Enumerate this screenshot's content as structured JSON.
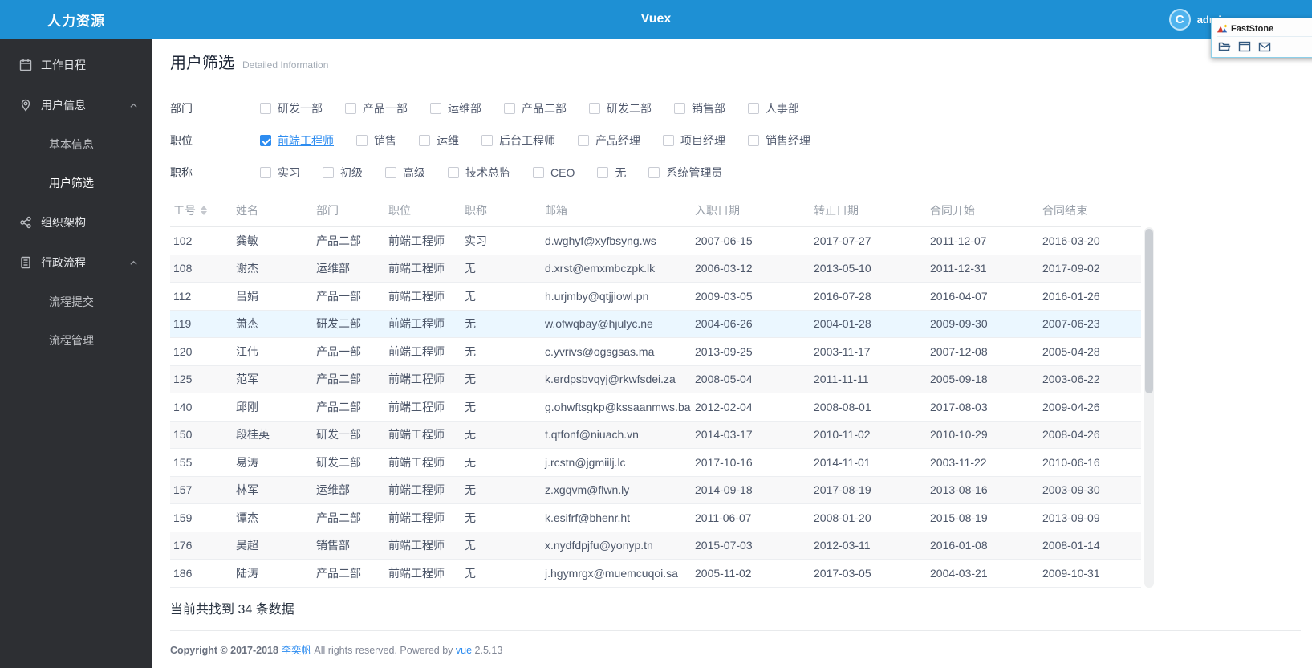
{
  "colors": {
    "header_blue": "#1e90d4",
    "accent_blue": "#2d8cf0",
    "sidebar_bg": "#2d2f33",
    "row_highlight": "#ebf7ff",
    "row_stripe": "#f8f8f9"
  },
  "header": {
    "app_title": "人力资源",
    "center_title": "Vuex",
    "username": "admin",
    "avatar_letter": "C"
  },
  "faststone": {
    "title": "FastStone",
    "icons": [
      "open-folder-icon",
      "window-icon",
      "envelope-icon"
    ]
  },
  "sidebar": {
    "items": [
      {
        "label": "工作日程",
        "icon": "calendar-icon"
      },
      {
        "label": "用户信息",
        "icon": "location-pin-icon",
        "expanded": true,
        "children": [
          "基本信息",
          "用户筛选"
        ]
      },
      {
        "label": "组织架构",
        "icon": "share-icon"
      },
      {
        "label": "行政流程",
        "icon": "document-icon",
        "expanded": true,
        "children": [
          "流程提交",
          "流程管理"
        ]
      }
    ],
    "active_item": "用户筛选"
  },
  "main": {
    "title": "用户筛选",
    "subtitle": "Detailed Information",
    "filters": [
      {
        "label": "部门",
        "options": [
          {
            "label": "研发一部",
            "checked": false
          },
          {
            "label": "产品一部",
            "checked": false
          },
          {
            "label": "运维部",
            "checked": false
          },
          {
            "label": "产品二部",
            "checked": false
          },
          {
            "label": "研发二部",
            "checked": false
          },
          {
            "label": "销售部",
            "checked": false
          },
          {
            "label": "人事部",
            "checked": false
          }
        ]
      },
      {
        "label": "职位",
        "options": [
          {
            "label": "前端工程师",
            "checked": true
          },
          {
            "label": "销售",
            "checked": false
          },
          {
            "label": "运维",
            "checked": false
          },
          {
            "label": "后台工程师",
            "checked": false
          },
          {
            "label": "产品经理",
            "checked": false
          },
          {
            "label": "项目经理",
            "checked": false
          },
          {
            "label": "销售经理",
            "checked": false
          }
        ]
      },
      {
        "label": "职称",
        "options": [
          {
            "label": "实习",
            "checked": false
          },
          {
            "label": "初级",
            "checked": false
          },
          {
            "label": "高级",
            "checked": false
          },
          {
            "label": "技术总监",
            "checked": false
          },
          {
            "label": "CEO",
            "checked": false
          },
          {
            "label": "无",
            "checked": false
          },
          {
            "label": "系统管理员",
            "checked": false
          }
        ]
      }
    ],
    "table": {
      "columns": [
        "工号",
        "姓名",
        "部门",
        "职位",
        "职称",
        "邮箱",
        "入职日期",
        "转正日期",
        "合同开始",
        "合同结束"
      ],
      "sortable_column": "工号",
      "highlighted_row_index": 3,
      "rows": [
        [
          "102",
          "龚敏",
          "产品二部",
          "前端工程师",
          "实习",
          "d.wghyf@xyfbsyng.ws",
          "2007-06-15",
          "2017-07-27",
          "2011-12-07",
          "2016-03-20"
        ],
        [
          "108",
          "谢杰",
          "运维部",
          "前端工程师",
          "无",
          "d.xrst@emxmbczpk.lk",
          "2006-03-12",
          "2013-05-10",
          "2011-12-31",
          "2017-09-02"
        ],
        [
          "112",
          "吕娟",
          "产品一部",
          "前端工程师",
          "无",
          "h.urjmby@qtjjiowl.pn",
          "2009-03-05",
          "2016-07-28",
          "2016-04-07",
          "2016-01-26"
        ],
        [
          "119",
          "萧杰",
          "研发二部",
          "前端工程师",
          "无",
          "w.ofwqbay@hjulyc.ne",
          "2004-06-26",
          "2004-01-28",
          "2009-09-30",
          "2007-06-23"
        ],
        [
          "120",
          "江伟",
          "产品一部",
          "前端工程师",
          "无",
          "c.yvrivs@ogsgsas.ma",
          "2013-09-25",
          "2003-11-17",
          "2007-12-08",
          "2005-04-28"
        ],
        [
          "125",
          "范军",
          "产品二部",
          "前端工程师",
          "无",
          "k.erdpsbvqyj@rkwfsdei.za",
          "2008-05-04",
          "2011-11-11",
          "2005-09-18",
          "2003-06-22"
        ],
        [
          "140",
          "邱刚",
          "产品二部",
          "前端工程师",
          "无",
          "g.ohwftsgkp@kssaanmws.ba",
          "2012-02-04",
          "2008-08-01",
          "2017-08-03",
          "2009-04-26"
        ],
        [
          "150",
          "段桂英",
          "研发一部",
          "前端工程师",
          "无",
          "t.qtfonf@niuach.vn",
          "2014-03-17",
          "2010-11-02",
          "2010-10-29",
          "2008-04-26"
        ],
        [
          "155",
          "易涛",
          "研发二部",
          "前端工程师",
          "无",
          "j.rcstn@jgmiilj.lc",
          "2017-10-16",
          "2014-11-01",
          "2003-11-22",
          "2010-06-16"
        ],
        [
          "157",
          "林军",
          "运维部",
          "前端工程师",
          "无",
          "z.xgqvm@flwn.ly",
          "2014-09-18",
          "2017-08-19",
          "2013-08-16",
          "2003-09-30"
        ],
        [
          "159",
          "谭杰",
          "产品二部",
          "前端工程师",
          "无",
          "k.esifrf@bhenr.ht",
          "2011-06-07",
          "2008-01-20",
          "2015-08-19",
          "2013-09-09"
        ],
        [
          "176",
          "吴超",
          "销售部",
          "前端工程师",
          "无",
          "x.nydfdpjfu@yonyp.tn",
          "2015-07-03",
          "2012-03-11",
          "2016-01-08",
          "2008-01-14"
        ],
        [
          "186",
          "陆涛",
          "产品二部",
          "前端工程师",
          "无",
          "j.hgymrgx@muemcuqoi.sa",
          "2005-11-02",
          "2017-03-05",
          "2004-03-21",
          "2009-10-31"
        ]
      ]
    },
    "summary": "当前共找到 34 条数据",
    "result_count": 34,
    "footer": {
      "copyright_prefix": "Copyright © 2017-2018 ",
      "author": "李奕帆",
      "rights": " All rights reserved. Powered by ",
      "framework": "vue",
      "version": " 2.5.13"
    }
  }
}
